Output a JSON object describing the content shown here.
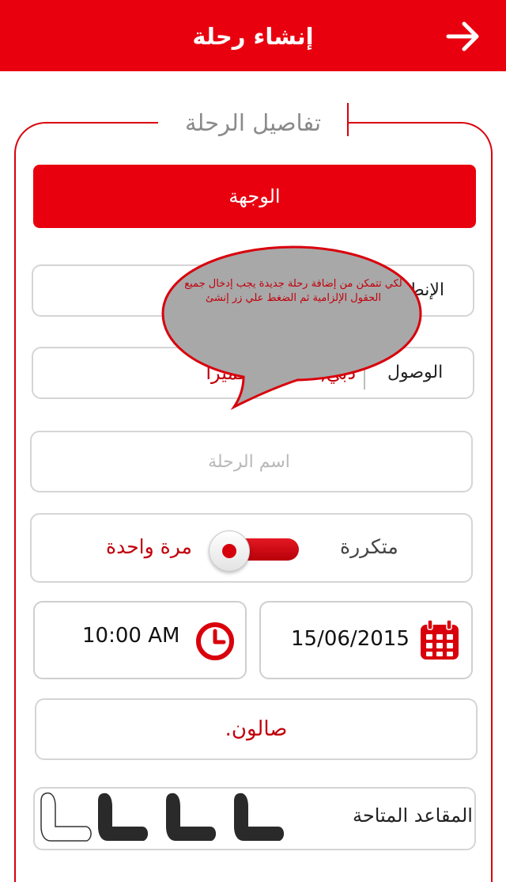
{
  "header": {
    "title": "إنشاء رحلة"
  },
  "section": {
    "legend": "تفاصيل الرحلة"
  },
  "destination": {
    "label": "الوجهة"
  },
  "departure": {
    "label": "الإنطلاق"
  },
  "arrival": {
    "label": "الوصول",
    "value": "دبي,شاطئ الجميرا"
  },
  "trip_name": {
    "placeholder": "اسم الرحلة",
    "value": ""
  },
  "recurrence": {
    "recurring_label": "متكررة",
    "once_label": "مرة واحدة",
    "selected": "مرة واحدة"
  },
  "time": {
    "value": "10:00 AM",
    "icon": "clock-icon"
  },
  "date": {
    "value": "15/06/2015",
    "icon": "calendar-icon"
  },
  "car_type": {
    "value": "صالون."
  },
  "seats": {
    "label": "المقاعد المتاحة",
    "total": 4,
    "selected": 3
  },
  "tooltip": {
    "text": "لكي تتمكن من إضافة رحلة جديدة يجب إدخال جميع الحقول الإلزامية ثم الضغط علي زر إنشئ"
  },
  "colors": {
    "accent": "#e8000f",
    "text_accent": "#c0000b",
    "border": "#d5d5d5"
  }
}
